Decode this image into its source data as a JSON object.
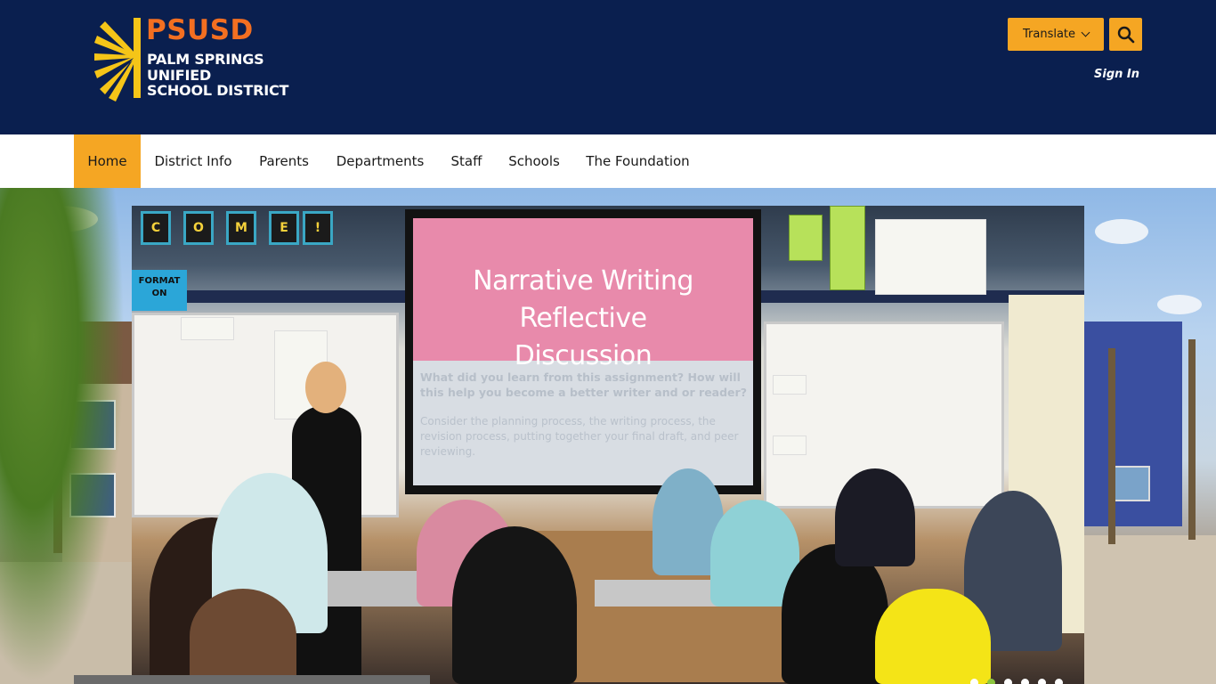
{
  "header": {
    "logo": {
      "acronym": "PSUSD",
      "line1": "PALM SPRINGS",
      "line2": "UNIFIED",
      "line3": "SCHOOL DISTRICT"
    },
    "translate_label": "Translate",
    "search_icon": "search-icon",
    "sign_in_label": "Sign In"
  },
  "colors": {
    "header_bg": "#0a1f4f",
    "accent": "#f5a623",
    "logo_orange": "#f36f21",
    "logo_yellow": "#f5c518"
  },
  "nav": {
    "items": [
      {
        "label": "Home",
        "active": true
      },
      {
        "label": "District Info"
      },
      {
        "label": "Parents"
      },
      {
        "label": "Departments"
      },
      {
        "label": "Staff"
      },
      {
        "label": "Schools"
      },
      {
        "label": "The Foundation"
      }
    ]
  },
  "hero": {
    "screen_title_line1": "Narrative Writing Reflective",
    "screen_title_line2": "Discussion",
    "screen_question": "What did you learn from this assignment? How will this help you become a better writer and or reader?",
    "screen_subtext": "Consider the planning process, the writing process, the revision process, putting together your final draft, and peer reviewing.",
    "banner_letters": [
      "C",
      "O",
      "M",
      "E",
      "!"
    ],
    "format_card": "FORMAT ON",
    "slide_count": 6,
    "active_slide": 2
  }
}
